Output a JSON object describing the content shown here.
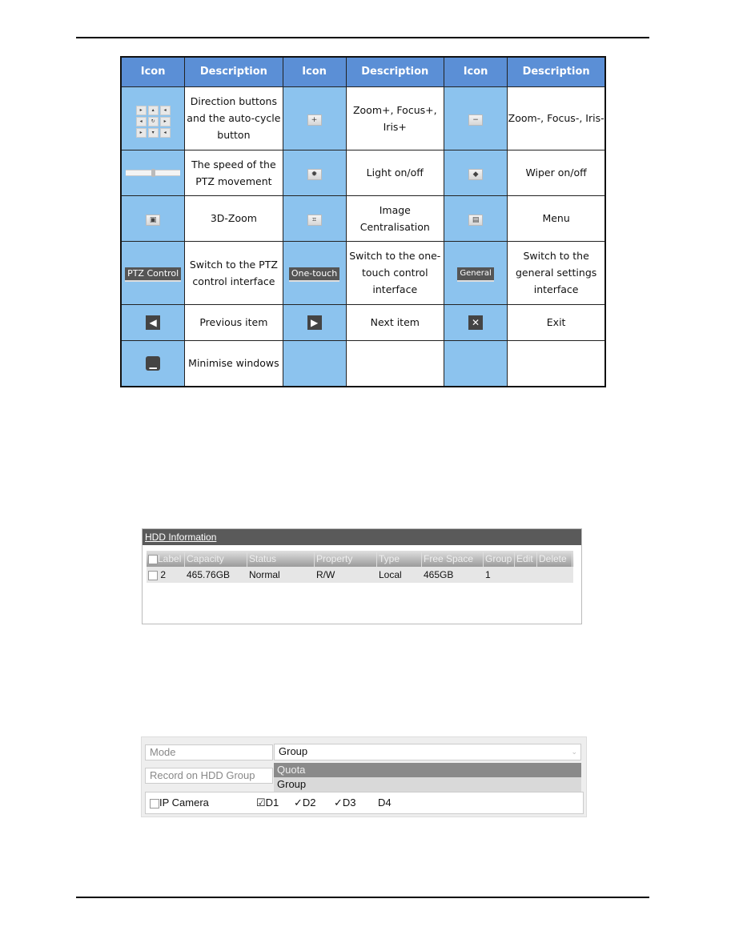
{
  "table": {
    "headers": [
      "Icon",
      "Description",
      "Icon",
      "Description",
      "Icon",
      "Description"
    ],
    "rows": [
      [
        {
          "icon": "direction-pad",
          "desc": "Direction buttons and the auto-cycle button"
        },
        {
          "icon": "plus",
          "desc": "Zoom+, Focus+, Iris+"
        },
        {
          "icon": "minus",
          "desc": "Zoom-, Focus-, Iris-"
        }
      ],
      [
        {
          "icon": "speed-slider",
          "desc": "The speed of the PTZ movement"
        },
        {
          "icon": "light",
          "desc": "Light on/off"
        },
        {
          "icon": "wiper",
          "desc": "Wiper on/off"
        }
      ],
      [
        {
          "icon": "3d-zoom",
          "desc": "3D-Zoom"
        },
        {
          "icon": "centralise",
          "desc": "Image Centralisation"
        },
        {
          "icon": "menu",
          "desc": "Menu"
        }
      ],
      [
        {
          "icon": "tab",
          "label": "PTZ Control",
          "desc": "Switch to the PTZ control interface"
        },
        {
          "icon": "tab",
          "label": "One-touch",
          "desc": "Switch to the one-touch control interface"
        },
        {
          "icon": "tab",
          "label": "General",
          "desc": "Switch to the general settings interface"
        }
      ],
      [
        {
          "icon": "previous",
          "desc": "Previous item"
        },
        {
          "icon": "next",
          "desc": "Next item"
        },
        {
          "icon": "exit",
          "desc": "Exit"
        }
      ],
      [
        {
          "icon": "minimise",
          "desc": "Minimise windows"
        },
        {
          "icon": "",
          "desc": ""
        },
        {
          "icon": "",
          "desc": ""
        }
      ]
    ]
  },
  "hdd": {
    "title": "HDD Information",
    "columns": [
      "Label",
      "Capacity",
      "Status",
      "Property",
      "Type",
      "Free Space",
      "Group",
      "Edit",
      "Delete"
    ],
    "row": [
      "2",
      "465.76GB",
      "Normal",
      "R/W",
      "Local",
      "465GB",
      "1",
      "",
      ""
    ]
  },
  "mode": {
    "mode_label": "Mode",
    "mode_value": "Group",
    "record_label": "Record on HDD Group",
    "options": [
      "Quota",
      "Group"
    ],
    "ip_camera": "IP Camera",
    "channels": [
      "D1",
      "D2",
      "D3",
      "D4"
    ]
  }
}
